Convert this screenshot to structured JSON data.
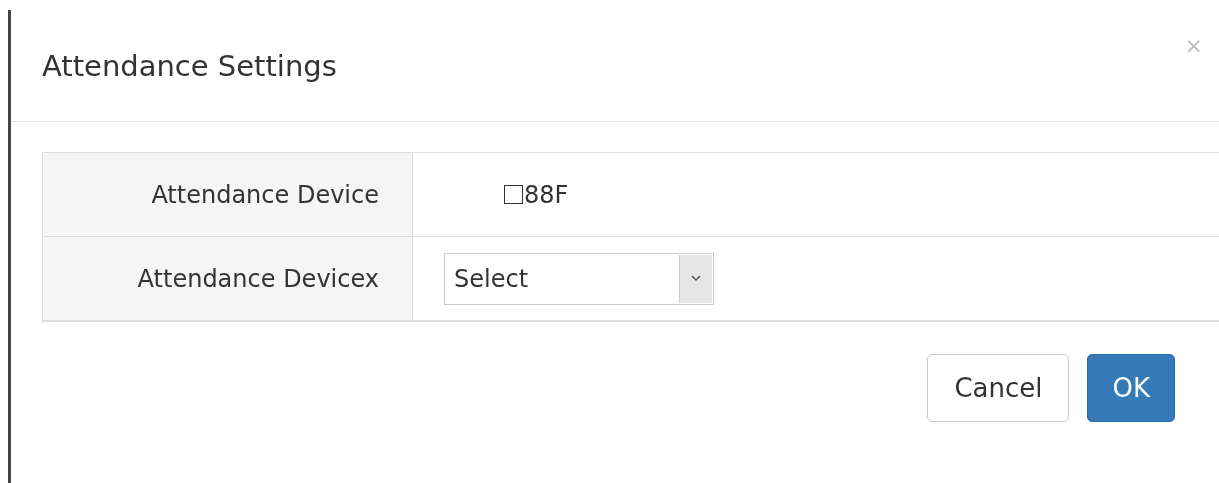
{
  "dialog": {
    "title": "Attendance Settings",
    "close": "×"
  },
  "rows": [
    {
      "kind": "checkbox",
      "label": "Attendance Device",
      "option": "88F",
      "checked": false
    },
    {
      "kind": "select",
      "label": "Attendance Devicex",
      "value": "Select"
    }
  ],
  "buttons": [
    {
      "label": "Cancel",
      "kind": "default"
    },
    {
      "label": "OK",
      "kind": "primary"
    }
  ]
}
